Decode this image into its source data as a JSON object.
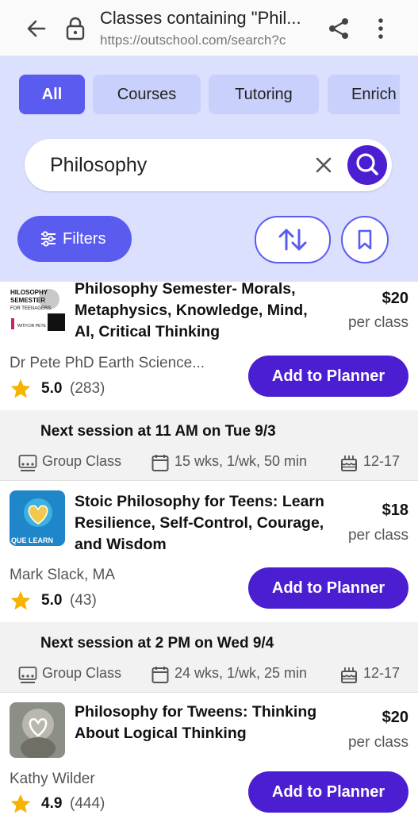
{
  "browser": {
    "title": "Classes containing \"Phil...",
    "url": "https://outschool.com/search?c"
  },
  "tabs": [
    {
      "label": "All",
      "active": true
    },
    {
      "label": "Courses",
      "active": false
    },
    {
      "label": "Tutoring",
      "active": false
    },
    {
      "label": "Enrich",
      "active": false
    }
  ],
  "search": {
    "value": "Philosophy"
  },
  "filters_label": "Filters",
  "colors": {
    "accent": "#5a5cf0",
    "primary": "#4b1fd1",
    "header_bg": "#dbe0ff",
    "star": "#f5b400"
  },
  "classes": [
    {
      "title": "Philosophy Semester- Morals, Metaphysics, Knowledge, Mind, AI, Critical Thinking",
      "price": "$20",
      "price_unit": "per class",
      "teacher": "Dr Pete PhD Earth Science...",
      "rating": "5.0",
      "reviews": "(283)",
      "planner_label": "Add to Planner",
      "next_session": "Next session at 11 AM on Tue 9/3",
      "type": "Group Class",
      "schedule": "15 wks, 1/wk, 50 min",
      "ages": "12-17",
      "thumb_text": "HILOSOPHY SEMESTER FOR TEENAGERS WITH DR PETE"
    },
    {
      "title": "Stoic Philosophy for Teens: Learn Resilience, Self-Control, Courage, and Wisdom",
      "price": "$18",
      "price_unit": "per class",
      "teacher": "Mark Slack, MA",
      "rating": "5.0",
      "reviews": "(43)",
      "planner_label": "Add to Planner",
      "next_session": "Next session at 2 PM on Wed 9/4",
      "type": "Group Class",
      "schedule": "24 wks, 1/wk, 25 min",
      "ages": "12-17",
      "thumb_text": "QUE LEARN"
    },
    {
      "title": "Philosophy for Tweens: Thinking About Logical Thinking",
      "price": "$20",
      "price_unit": "per class",
      "teacher": "Kathy Wilder",
      "rating": "4.9",
      "reviews": "(444)",
      "planner_label": "Add to Planner"
    }
  ]
}
